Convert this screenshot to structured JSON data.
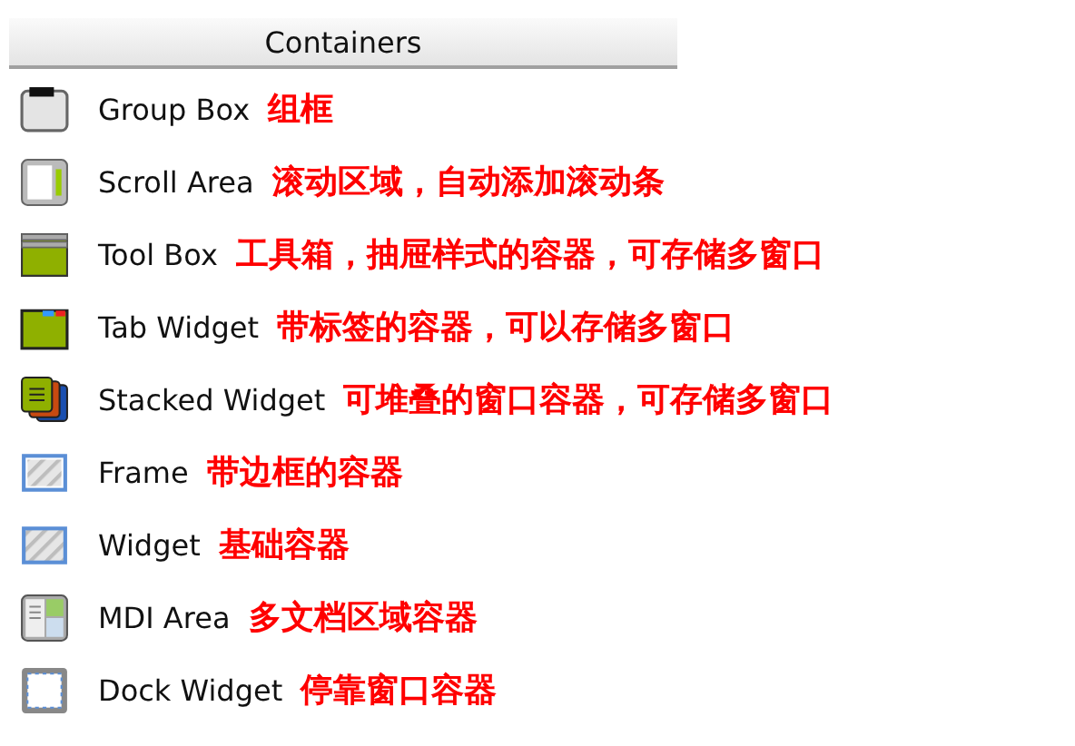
{
  "header": "Containers",
  "items": [
    {
      "kind": "groupbox",
      "label": "Group Box",
      "note": "组框"
    },
    {
      "kind": "scrollarea",
      "label": "Scroll Area",
      "note": "滚动区域，自动添加滚动条"
    },
    {
      "kind": "toolbox",
      "label": "Tool Box",
      "note": "工具箱，抽屉样式的容器，可存储多窗口"
    },
    {
      "kind": "tabwidget",
      "label": "Tab Widget",
      "note": "带标签的容器，可以存储多窗口"
    },
    {
      "kind": "stacked",
      "label": "Stacked Widget",
      "note": "可堆叠的窗口容器，可存储多窗口"
    },
    {
      "kind": "frame",
      "label": "Frame",
      "note": "带边框的容器"
    },
    {
      "kind": "widget",
      "label": "Widget",
      "note": "基础容器"
    },
    {
      "kind": "mdi",
      "label": "MDI Area",
      "note": "多文档区域容器"
    },
    {
      "kind": "dock",
      "label": "Dock Widget",
      "note": "停靠窗口容器"
    }
  ]
}
